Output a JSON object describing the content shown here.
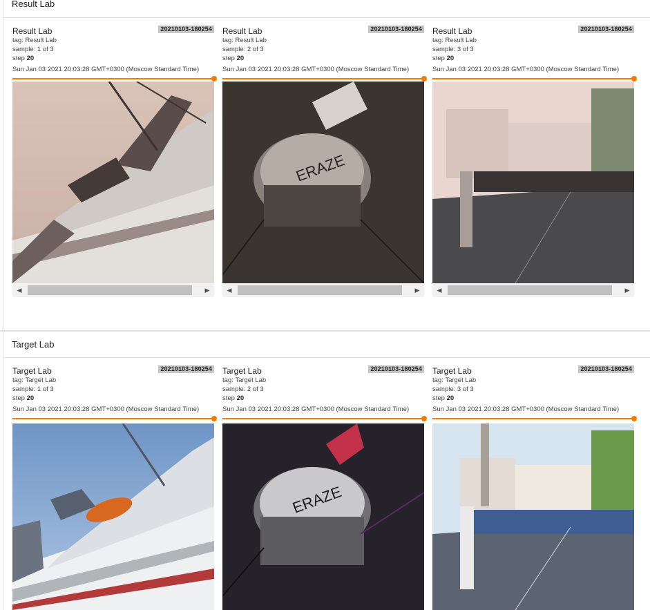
{
  "sections": [
    {
      "title": "Result Lab",
      "cards": [
        {
          "title": "Result Lab",
          "run": "20210103-180254",
          "tag": "tag: Result Lab",
          "sample": "sample: 1 of 3",
          "step_label": "step",
          "step": "20",
          "time": "Sun Jan 03 2021 20:03:28 GMT+0300 (Moscow Standard Time)",
          "image": "ship"
        },
        {
          "title": "Result Lab",
          "run": "20210103-180254",
          "tag": "tag: Result Lab",
          "sample": "sample: 2 of 3",
          "step_label": "step",
          "step": "20",
          "time": "Sun Jan 03 2021 20:03:28 GMT+0300 (Moscow Standard Time)",
          "image": "drum",
          "drum_text": "ERAZE"
        },
        {
          "title": "Result Lab",
          "run": "20210103-180254",
          "tag": "tag: Result Lab",
          "sample": "sample: 3 of 3",
          "step_label": "step",
          "step": "20",
          "time": "Sun Jan 03 2021 20:03:28 GMT+0300 (Moscow Standard Time)",
          "image": "street"
        }
      ]
    },
    {
      "title": "Target Lab",
      "cards": [
        {
          "title": "Target Lab",
          "run": "20210103-180254",
          "tag": "tag: Target Lab",
          "sample": "sample: 1 of 3",
          "step_label": "step",
          "step": "20",
          "time": "Sun Jan 03 2021 20:03:28 GMT+0300 (Moscow Standard Time)",
          "image": "ship"
        },
        {
          "title": "Target Lab",
          "run": "20210103-180254",
          "tag": "tag: Target Lab",
          "sample": "sample: 2 of 3",
          "step_label": "step",
          "step": "20",
          "time": "Sun Jan 03 2021 20:03:28 GMT+0300 (Moscow Standard Time)",
          "image": "drum",
          "drum_text": "ERAZE"
        },
        {
          "title": "Target Lab",
          "run": "20210103-180254",
          "tag": "tag: Target Lab",
          "sample": "sample: 3 of 3",
          "step_label": "step",
          "step": "20",
          "time": "Sun Jan 03 2021 20:03:28 GMT+0300 (Moscow Standard Time)",
          "image": "street"
        }
      ]
    }
  ],
  "scrollbar": {
    "left_icon": "arrow-left-icon",
    "right_icon": "arrow-right-icon",
    "left_glyph": "◀",
    "right_glyph": "▶"
  },
  "colors": {
    "accent": "#f57c00",
    "badge": "#c6c6c6",
    "border": "#e0e0e0"
  }
}
